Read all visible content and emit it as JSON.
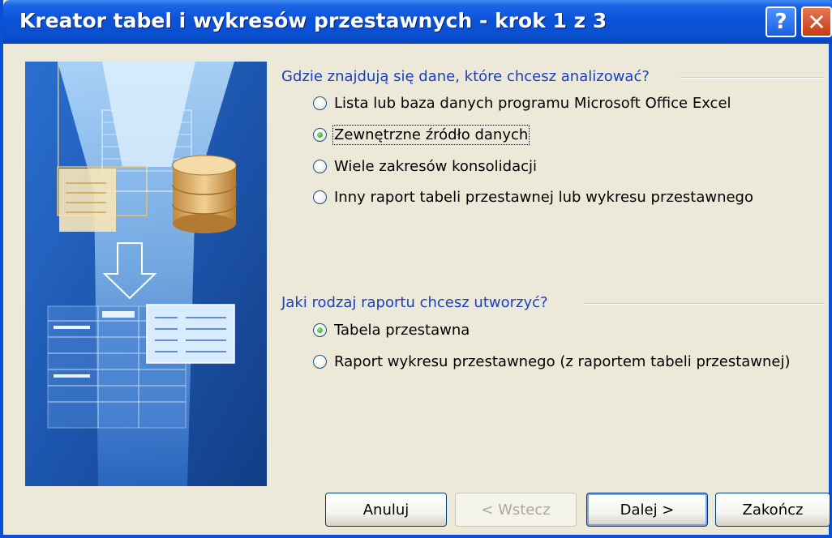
{
  "window": {
    "title": "Kreator tabel i wykresów przestawnych - krok 1 z 3"
  },
  "titlebar": {
    "help_label": "?",
    "close_label": "✕"
  },
  "data_source": {
    "label": "Gdzie znajdują się dane, które chcesz analizować?",
    "options": [
      {
        "label": "Lista lub baza danych programu Microsoft Office Excel",
        "checked": false
      },
      {
        "label": "Zewnętrzne źródło danych",
        "checked": true
      },
      {
        "label": "Wiele zakresów konsolidacji",
        "checked": false
      },
      {
        "label": "Inny raport tabeli przestawnej lub wykresu przestawnego",
        "checked": false
      }
    ]
  },
  "report_type": {
    "label": "Jaki rodzaj raportu chcesz utworzyć?",
    "options": [
      {
        "label": "Tabela przestawna",
        "checked": true
      },
      {
        "label": "Raport wykresu przestawnego (z raportem tabeli przestawnej)",
        "checked": false
      }
    ]
  },
  "buttons": {
    "cancel": "Anuluj",
    "back": "< Wstecz",
    "next": "Dalej >",
    "finish": "Zakończ"
  }
}
